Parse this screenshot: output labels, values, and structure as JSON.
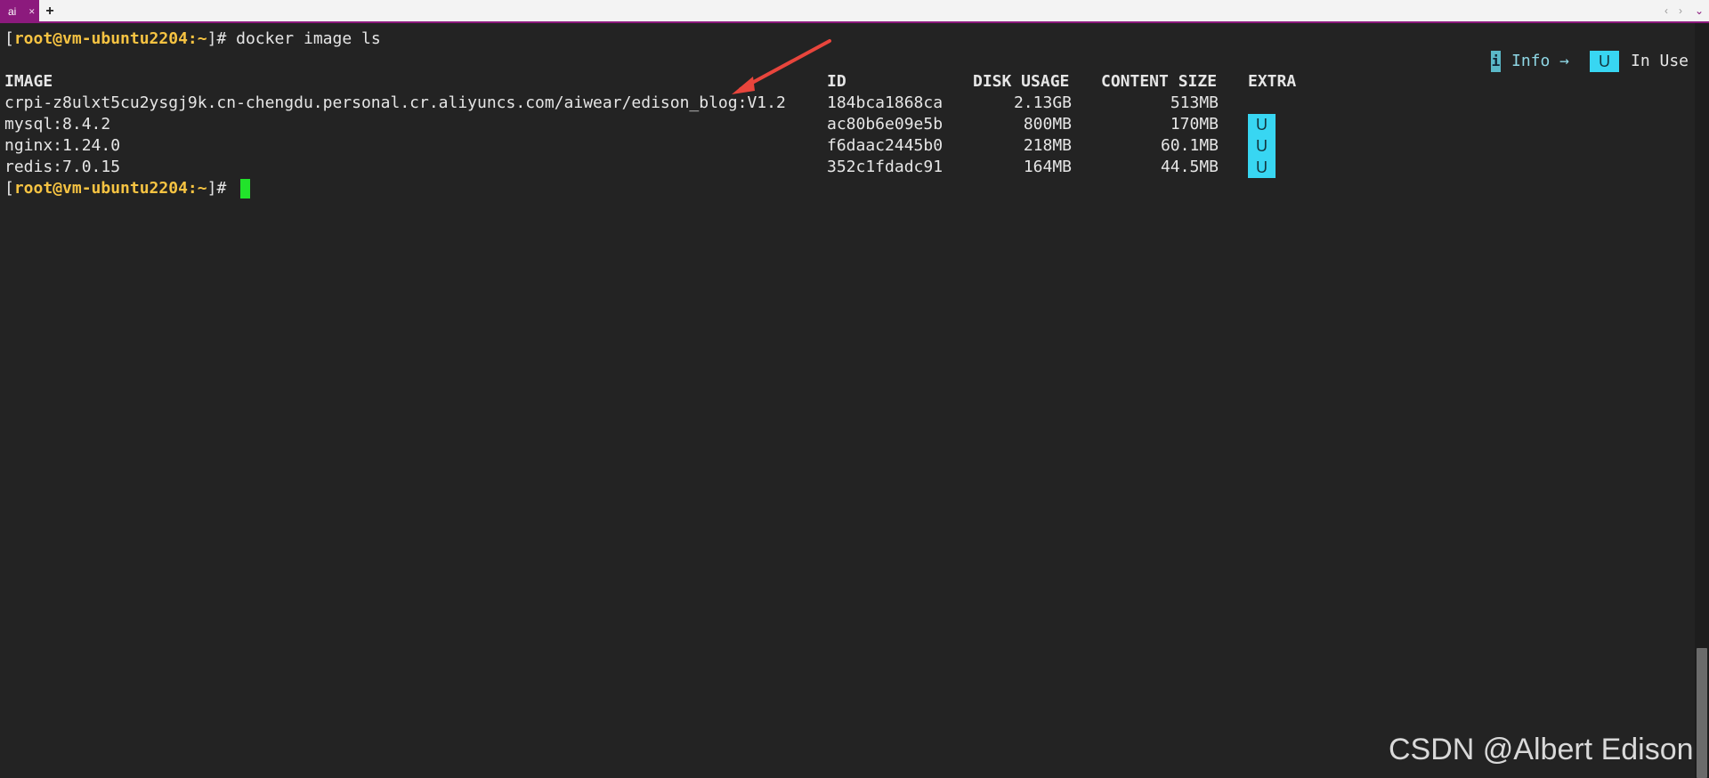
{
  "tabbar": {
    "active_tab_label": "ai",
    "add_tab_symbol": "+",
    "scroll_left_symbol": "‹",
    "scroll_right_symbol": "›",
    "menu_symbol": "⌄"
  },
  "terminal": {
    "prompt_open": "[",
    "prompt_user_host": "root@vm-ubuntu2204",
    "prompt_path": ":~",
    "prompt_close": "]# ",
    "command": "docker image ls",
    "headers": {
      "image": "IMAGE",
      "id": "ID",
      "disk_usage": "DISK USAGE",
      "content_size": "CONTENT SIZE",
      "extra": "EXTRA"
    },
    "rows": [
      {
        "image": "crpi-z8ulxt5cu2ysgj9k.cn-chengdu.personal.cr.aliyuncs.com/aiwear/edison_blog:V1.2",
        "id": "184bca1868ca",
        "disk_usage": "2.13GB",
        "content_size": "513MB",
        "extra": ""
      },
      {
        "image": "mysql:8.4.2",
        "id": "ac80b6e09e5b",
        "disk_usage": "800MB",
        "content_size": "170MB",
        "extra": "U"
      },
      {
        "image": "nginx:1.24.0",
        "id": "f6daac2445b0",
        "disk_usage": "218MB",
        "content_size": "60.1MB",
        "extra": "U"
      },
      {
        "image": "redis:7.0.15",
        "id": "352c1fdadc91",
        "disk_usage": "164MB",
        "content_size": "44.5MB",
        "extra": "U"
      }
    ],
    "legend": {
      "info_key": "i",
      "info_label": "Info →",
      "in_use_key": "U",
      "in_use_label": "In Use"
    },
    "colors": {
      "background": "#232323",
      "prompt": "#f6c342",
      "image_name": "#7fa9d1",
      "badge": "#38d6f2",
      "cursor": "#22e32b",
      "annotation_arrow": "#e8453c",
      "tab_accent": "#8c1a7d"
    }
  },
  "watermark": "CSDN @Albert Edison"
}
